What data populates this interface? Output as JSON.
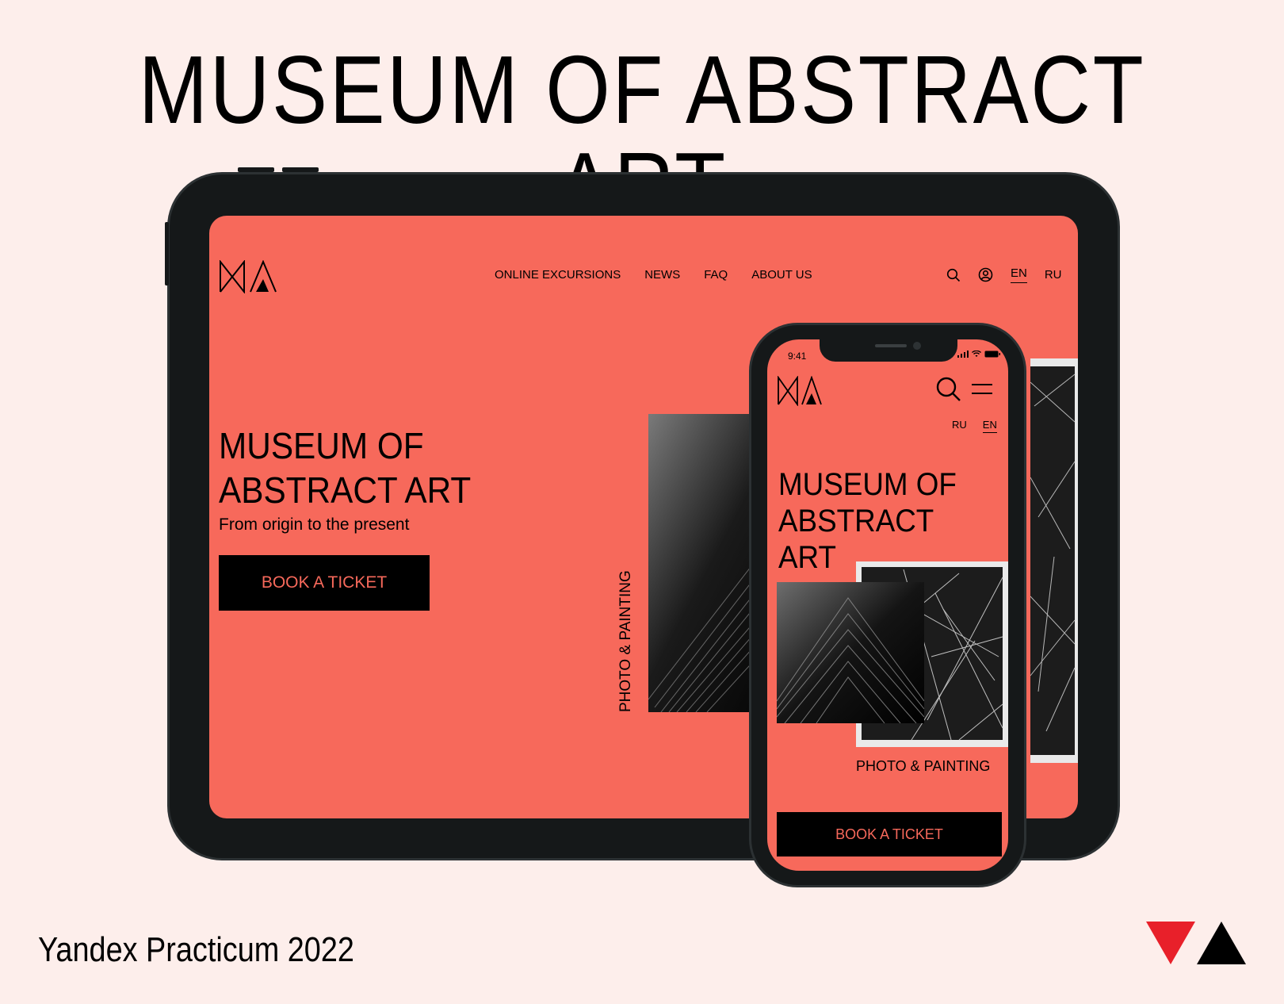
{
  "heading": "MUSEUM OF ABSTRACT ART",
  "footer": "Yandex Practicum 2022",
  "colors": {
    "background": "#fdeeeb",
    "accent": "#f7695b",
    "device": "#151819"
  },
  "tablet": {
    "logo": "MA",
    "nav": [
      "ONLINE EXCURSIONS",
      "NEWS",
      "FAQ",
      "ABOUT US"
    ],
    "lang_en": "EN",
    "lang_ru": "RU",
    "title_line1": "MUSEUM OF",
    "title_line2": "ABSTRACT ART",
    "subtitle": "From origin to the present",
    "cta": "BOOK A TICKET",
    "section_label": "PHOTO & PAINTING",
    "icons": [
      "search-icon",
      "user-icon"
    ]
  },
  "phone": {
    "time": "9:41",
    "logo": "MA",
    "lang_ru": "RU",
    "lang_en": "EN",
    "title_line1": "MUSEUM OF",
    "title_line2": "ABSTRACT ART",
    "section_label": "PHOTO & PAINTING",
    "cta": "BOOK A TICKET",
    "icons": [
      "search-icon",
      "menu-icon",
      "signal-icon",
      "wifi-icon",
      "battery-icon"
    ]
  }
}
